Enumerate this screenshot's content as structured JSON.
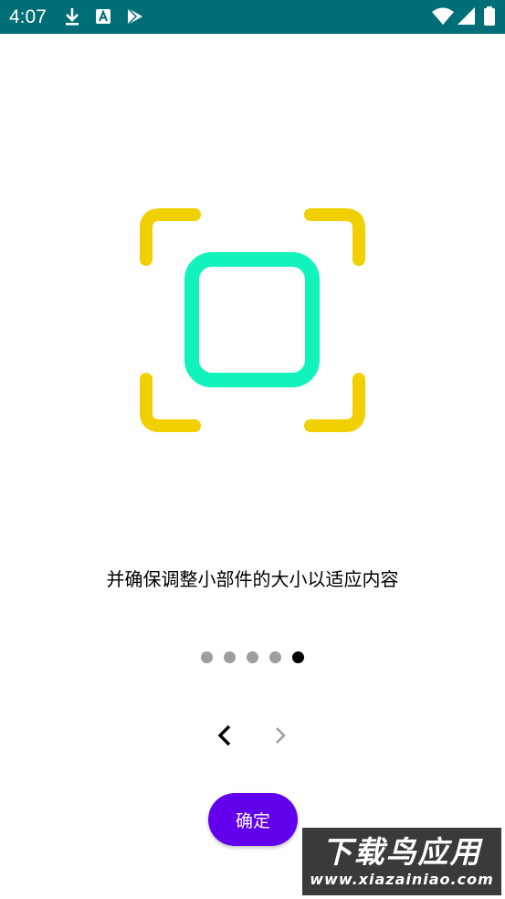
{
  "status_bar": {
    "time": "4:07",
    "background": "#006e77",
    "icons_left": [
      "download-icon",
      "font-app-icon",
      "play-store-icon"
    ],
    "icons_right": [
      "wifi-icon",
      "cellular-signal-icon",
      "battery-icon"
    ]
  },
  "illustration": {
    "icon": "widget-resize-frame-icon",
    "frame_color": "#f0d000",
    "square_color": "#12f2bd"
  },
  "onboarding": {
    "instruction": "并确保调整小部件的大小以适应内容",
    "page_total": 5,
    "page_current": 5,
    "prev_icon": "chevron-left-icon",
    "next_icon": "chevron-right-icon"
  },
  "confirm_button": {
    "label": "确定",
    "color": "#6200ee"
  },
  "watermark": {
    "title": "下载鸟应用",
    "url": "www.xiazainiao.com"
  }
}
